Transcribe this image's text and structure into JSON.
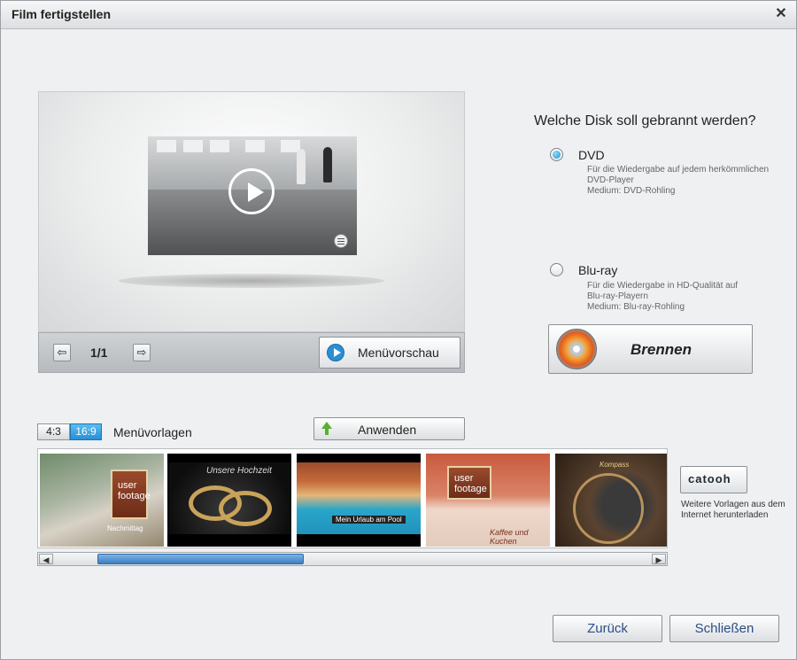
{
  "window": {
    "title": "Film fertigstellen",
    "close_glyph": "✕"
  },
  "preview": {
    "page_indicator": "1/1",
    "prev_glyph": "⇦",
    "next_glyph": "⇨",
    "menu_preview_label": "Menüvorschau"
  },
  "disk": {
    "question": "Welche Disk soll gebrannt werden?",
    "options": [
      {
        "title": "DVD",
        "selected": true,
        "desc": [
          "Für die Wiedergabe auf jedem herkömmlichen",
          "DVD-Player",
          "Medium: DVD-Rohling"
        ]
      },
      {
        "title": "Blu-ray",
        "selected": false,
        "desc": [
          "Für die Wiedergabe in HD-Qualität auf",
          "Blu-ray-Playern",
          "Medium: Blu-ray-Rohling"
        ]
      }
    ],
    "burn_label": "Brennen"
  },
  "templates": {
    "ratio_43": "4:3",
    "ratio_169": "16:9",
    "active_ratio": "16:9",
    "heading": "Menüvorlagen",
    "apply_label": "Anwenden",
    "tiles": [
      {
        "name": "Nachmittag",
        "board_text": "user\nfootage"
      },
      {
        "name": "Unsere Hochzeit"
      },
      {
        "name": "Mein Urlaub am Pool"
      },
      {
        "name": "Kaffee und Kuchen",
        "board_text": "user\nfootage"
      },
      {
        "name": "Kompass"
      }
    ],
    "catooh_label": "catooh",
    "catooh_desc": "Weitere Vorlagen aus dem Internet herunterladen"
  },
  "footer": {
    "back_label": "Zurück",
    "close_label": "Schließen"
  },
  "colors": {
    "accent": "#2a8fd4",
    "selection_blue": "#1f92d0",
    "footer_text": "#2a4f86"
  }
}
